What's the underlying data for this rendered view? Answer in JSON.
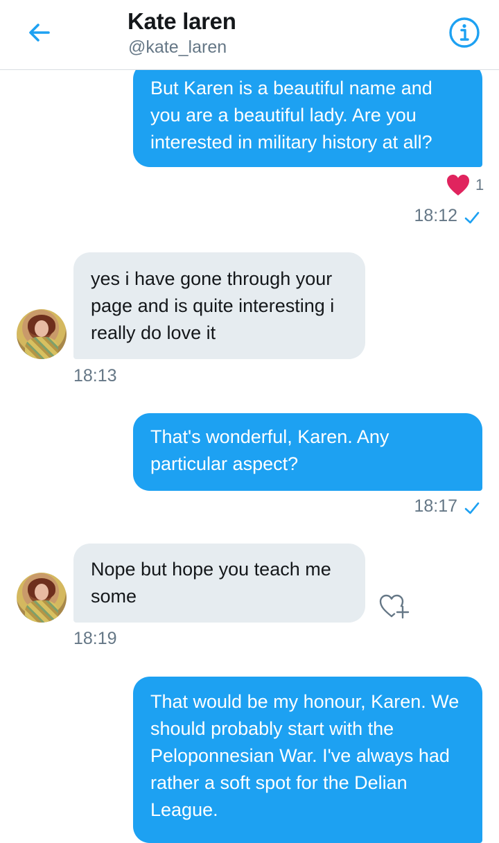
{
  "header": {
    "title": "Kate laren",
    "handle": "@kate_laren",
    "back_icon": "arrow-left-icon",
    "info_icon": "info-icon",
    "accent_color": "#1da1f2"
  },
  "messages": [
    {
      "direction": "sent",
      "text": "But Karen is a beautiful name and you are a beautiful lady. Are you interested in military history at all?",
      "reaction": {
        "icon": "heart-icon",
        "count": "1",
        "color": "#e0245e"
      },
      "time": "18:12",
      "status_icon": "check-icon"
    },
    {
      "direction": "received",
      "text": "yes i have gone through your page and is quite interesting i really do love it",
      "time": "18:13",
      "avatar": "avatar"
    },
    {
      "direction": "sent",
      "text": "That's wonderful, Karen. Any particular aspect?",
      "time": "18:17",
      "status_icon": "check-icon"
    },
    {
      "direction": "received",
      "text": "Nope but hope you teach me some",
      "time": "18:19",
      "avatar": "avatar",
      "action_icon": "add-reaction-heart-icon"
    },
    {
      "direction": "sent",
      "text": "That would be my honour, Karen. We should probably start with the Peloponnesian War. I've always had rather a soft spot for the Delian League."
    }
  ]
}
